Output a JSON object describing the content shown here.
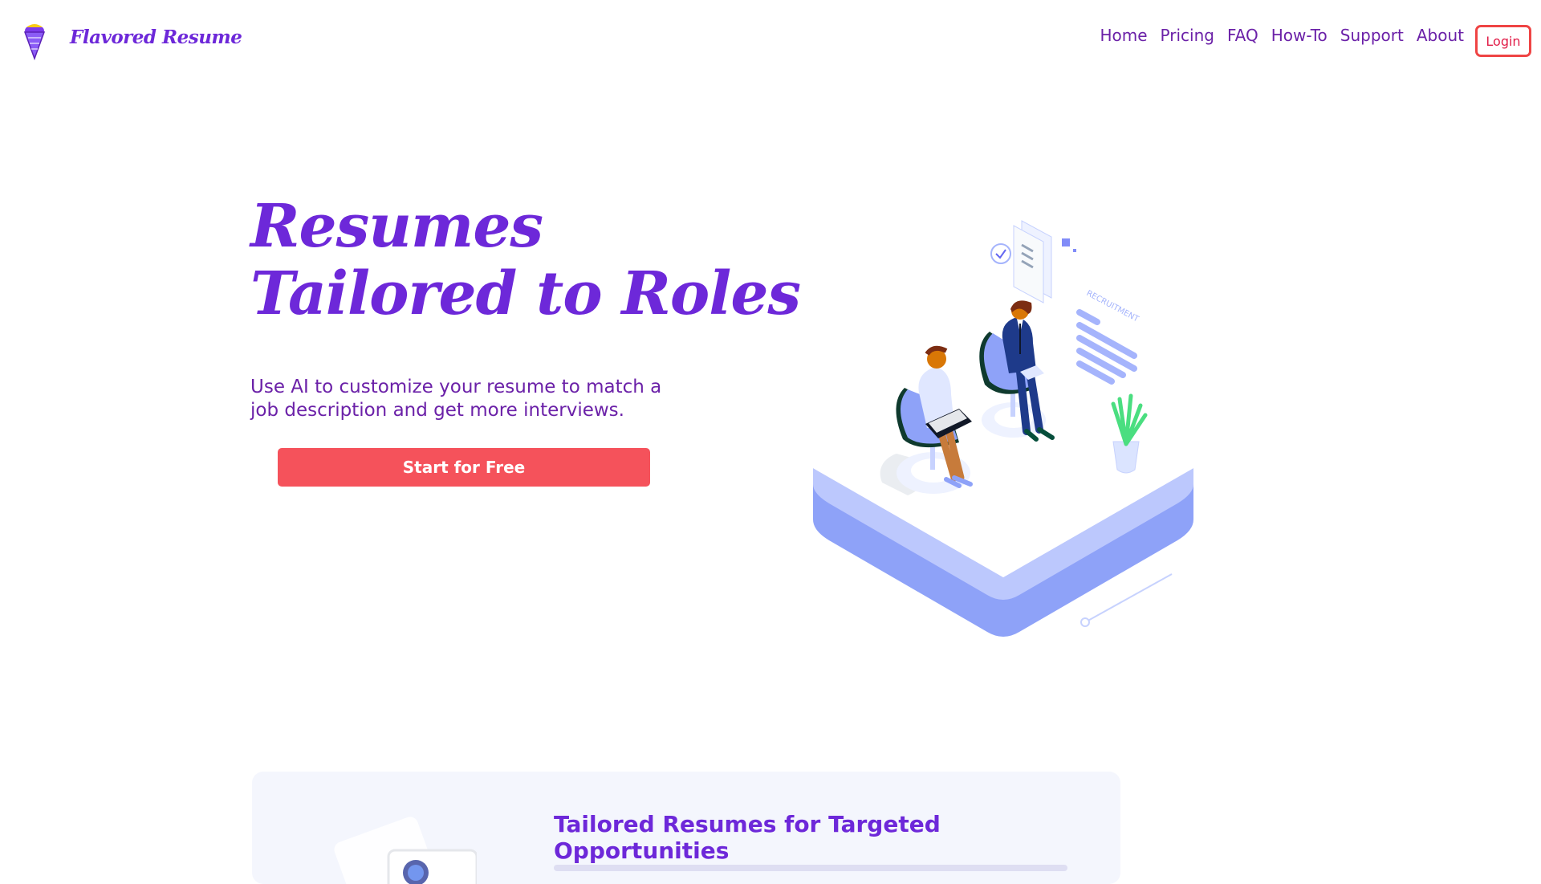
{
  "brand": {
    "name": "Flavored Resume",
    "logo": "ice-cream-cone-icon"
  },
  "nav": {
    "items": [
      {
        "label": "Home"
      },
      {
        "label": "Pricing"
      },
      {
        "label": "FAQ"
      },
      {
        "label": "How-To"
      },
      {
        "label": "Support"
      },
      {
        "label": "About"
      }
    ],
    "login_label": "Login"
  },
  "hero": {
    "title_line1": "Resumes",
    "title_line2": "Tailored to Roles",
    "subtitle": "Use AI to customize your resume to match a job description and get more interviews.",
    "cta_label": "Start for Free",
    "illustration_text": "RECRUITMENT"
  },
  "feature": {
    "title": "Tailored Resumes for Targeted Opportunities"
  },
  "colors": {
    "accent": "#6d28d9",
    "cta": "#f5525b",
    "login_border": "#ef4444",
    "card_bg": "#f4f6fd",
    "platform": "#8b9cf6"
  }
}
